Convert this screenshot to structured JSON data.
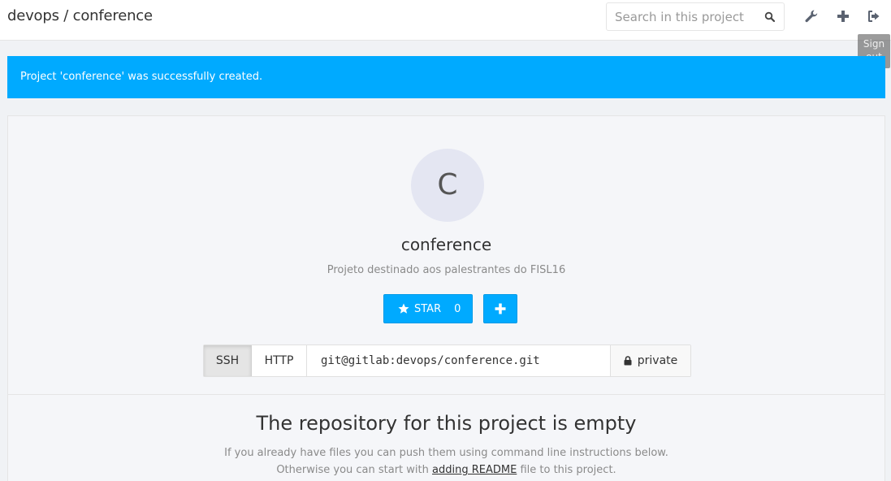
{
  "header": {
    "breadcrumb": "devops / conference",
    "search_placeholder": "Search in this project",
    "icons": [
      "search-icon",
      "wrench-icon",
      "plus-icon",
      "sign-out-icon"
    ],
    "tooltip": "Sign out"
  },
  "flash": {
    "message": "Project 'conference' was successfully created."
  },
  "project": {
    "avatar_letter": "C",
    "name": "conference",
    "description": "Projeto destinado aos palestrantes do FISL16",
    "star_label": "STAR",
    "star_count": "0"
  },
  "clone": {
    "ssh_label": "SSH",
    "http_label": "HTTP",
    "url": "git@gitlab:devops/conference.git",
    "visibility": "private"
  },
  "empty": {
    "title": "The repository for this project is empty",
    "line1": "If you already have files you can push them using command line instructions below.",
    "line2_before": "Otherwise you can start with",
    "line2_link": "adding README",
    "line2_after": "file to this project."
  },
  "colors": {
    "accent": "#00aaff",
    "page_bg": "#f0f2f5",
    "avatar_bg": "#e4e6f2"
  }
}
